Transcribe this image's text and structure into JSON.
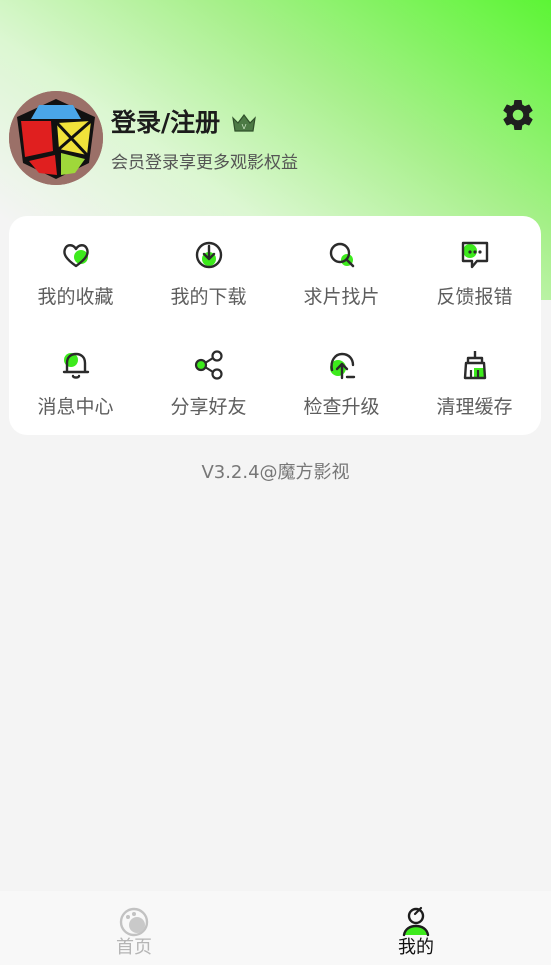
{
  "profile": {
    "login_label": "登录/注册",
    "subtitle": "会员登录享更多观影权益"
  },
  "menu": {
    "items": [
      {
        "label": "我的收藏",
        "icon": "heart-icon"
      },
      {
        "label": "我的下载",
        "icon": "download-icon"
      },
      {
        "label": "求片找片",
        "icon": "search-film-icon"
      },
      {
        "label": "反馈报错",
        "icon": "feedback-icon"
      },
      {
        "label": "消息中心",
        "icon": "bell-icon"
      },
      {
        "label": "分享好友",
        "icon": "share-icon"
      },
      {
        "label": "检查升级",
        "icon": "upgrade-icon"
      },
      {
        "label": "清理缓存",
        "icon": "broom-icon"
      }
    ]
  },
  "version": "V3.2.4@魔方影视",
  "tabbar": {
    "home": {
      "label": "首页",
      "icon": "home-icon"
    },
    "mine": {
      "label": "我的",
      "icon": "user-icon"
    }
  },
  "colors": {
    "accent": "#3dea1c",
    "icon_stroke": "#2b2b2b",
    "tab_active": "#111111",
    "tab_inactive": "#b5b5b5"
  }
}
